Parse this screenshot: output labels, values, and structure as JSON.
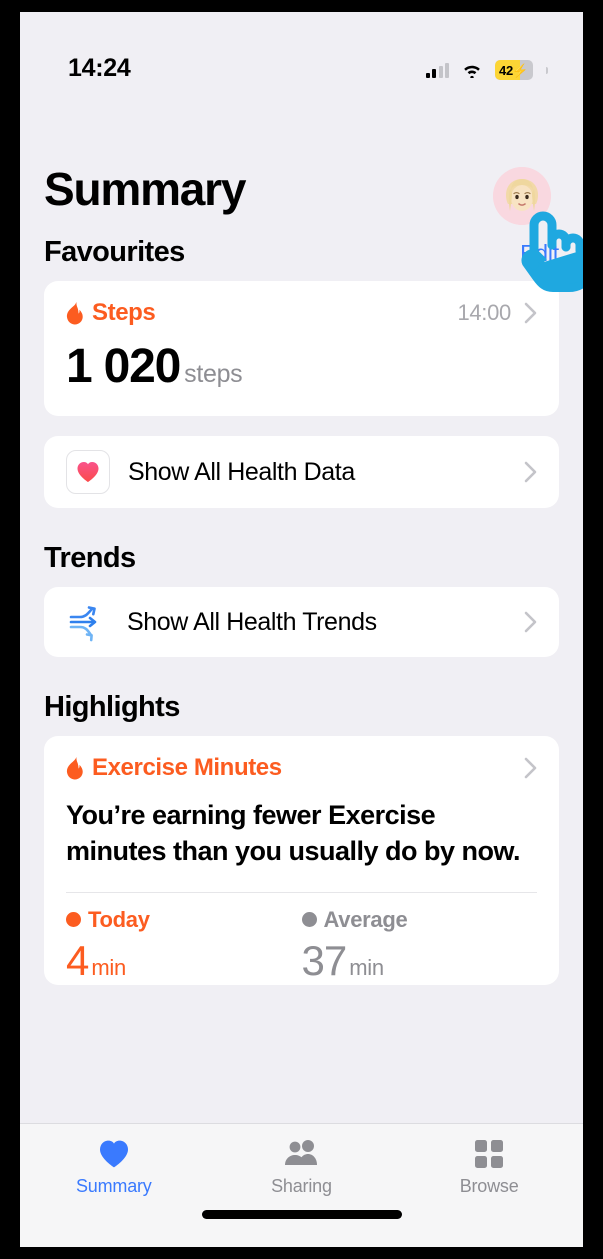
{
  "status_bar": {
    "time": "14:24",
    "battery_percent": "42",
    "battery_charging": true,
    "cell_icon": "cellular-bars-icon",
    "wifi_icon": "wifi-icon",
    "battery_icon": "battery-icon",
    "battery_fill_color": "#fcd535"
  },
  "header": {
    "title": "Summary",
    "avatar": "profile-avatar",
    "edit_label": "Edit"
  },
  "favourites": {
    "section_title": "Favourites",
    "steps_card": {
      "icon": "flame-icon",
      "label": "Steps",
      "time": "14:00",
      "value": "1 020",
      "unit": "steps",
      "accent_color": "#fc5c20"
    },
    "show_all_health_data": {
      "icon": "health-heart-icon",
      "label": "Show All Health Data"
    }
  },
  "trends": {
    "section_title": "Trends",
    "show_all_health_trends": {
      "icon": "trends-arrows-icon",
      "label": "Show All Health Trends"
    }
  },
  "highlights": {
    "section_title": "Highlights",
    "card": {
      "icon": "flame-icon",
      "label": "Exercise Minutes",
      "body": "You’re earning fewer Exercise minutes than you usually do by now.",
      "accent_color": "#fc5c20",
      "stats": [
        {
          "legend": "Today",
          "value": "4",
          "unit": "min",
          "color": "#fc5c20",
          "dot": "today-dot"
        },
        {
          "legend": "Average",
          "value": "37",
          "unit": "min",
          "color": "#8e8e93",
          "dot": "average-dot"
        }
      ]
    }
  },
  "tab_bar": {
    "active_color": "#3a7afe",
    "inactive_color": "#8e8e93",
    "tabs": [
      {
        "label": "Summary",
        "icon": "heart-icon",
        "active": true
      },
      {
        "label": "Sharing",
        "icon": "people-icon",
        "active": false
      },
      {
        "label": "Browse",
        "icon": "grid-icon",
        "active": false
      }
    ]
  }
}
